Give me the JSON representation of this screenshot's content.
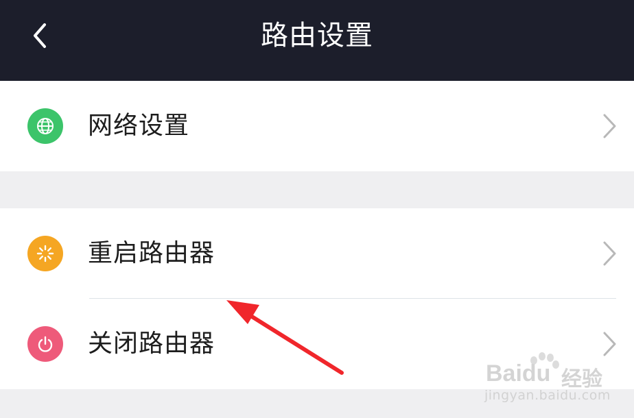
{
  "header": {
    "title": "路由设置",
    "back_icon": "chevron-left-icon"
  },
  "menu": {
    "network_settings": {
      "label": "网络设置",
      "icon": "globe-icon",
      "icon_color": "#3cc46a"
    },
    "restart_router": {
      "label": "重启路由器",
      "icon": "loading-spinner-icon",
      "icon_color": "#f5a623"
    },
    "shutdown_router": {
      "label": "关闭路由器",
      "icon": "power-icon",
      "icon_color": "#ee5a7a"
    }
  },
  "watermark": {
    "brand": "Baidu",
    "suffix": "经验",
    "url": "jingyan.baidu.com"
  },
  "annotation": {
    "arrow_color": "#f0262b"
  }
}
